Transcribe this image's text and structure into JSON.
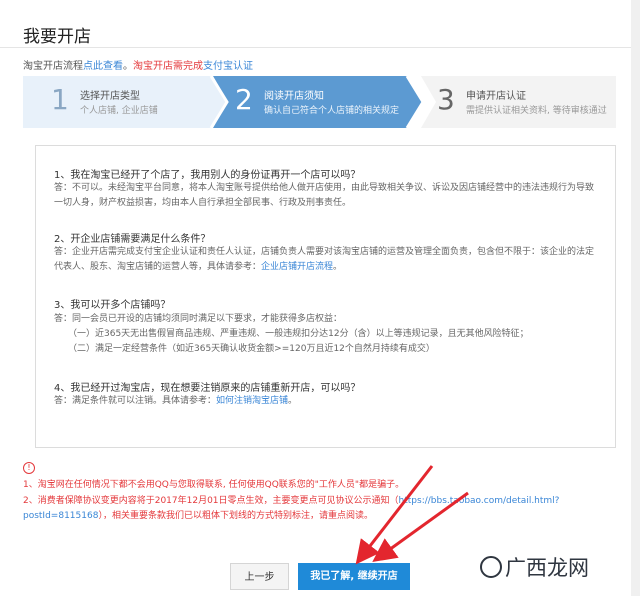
{
  "page": {
    "title": "我要开店"
  },
  "intro": {
    "prefix": "淘宝开店流程",
    "link": "点此查看",
    "sep": "。",
    "red_text": "淘宝开店需完成",
    "red_link": "支付宝认证"
  },
  "steps": [
    {
      "num": "1",
      "title": "选择开店类型",
      "desc": "个人店铺, 企业店铺"
    },
    {
      "num": "2",
      "title": "阅读开店须知",
      "desc": "确认自己符合个人店铺的相关规定"
    },
    {
      "num": "3",
      "title": "申请开店认证",
      "desc": "需提供认证相关资料, 等待审核通过"
    }
  ],
  "faq": [
    {
      "q": "1、我在淘宝已经开了个店了，我用别人的身份证再开一个店可以吗？",
      "a": "答：不可以。未经淘宝平台同意，将本人淘宝账号提供给他人做开店使用，由此导致相关争议、诉讼及因店铺经营中的违法违规行为导致一切人身，财产权益损害，均由本人自行承担全部民事、行政及刑事责任。"
    },
    {
      "q": "2、开企业店铺需要满足什么条件？",
      "a_pre": "答：企业开店需完成支付宝企业认证和责任人认证，店铺负责人需要对该淘宝店铺的运营及管理全面负责，包含但不限于：该企业的法定代表人、股东、淘宝店铺的运营人等，具体请参考：",
      "a_link": "企业店铺开店流程",
      "a_post": "。"
    },
    {
      "q": "3、我可以开多个店铺吗？",
      "a": "答：同一会员已开设的店铺均须同时满足以下要求，才能获得多店权益：",
      "a2": "（一）近365天无出售假冒商品违规、严重违规、一般违规扣分达12分（含）以上等违规记录，且无其他风险特征；",
      "a3": "（二）满足一定经营条件（如近365天确认收货金额>=120万且近12个自然月持续有成交）"
    },
    {
      "q": "4、我已经开过淘宝店，现在想要注销原来的店铺重新开店，可以吗？",
      "a_pre": "答：满足条件就可以注销。具体请参考：",
      "a_link": "如何注销淘宝店铺",
      "a_post": "。"
    }
  ],
  "notice": {
    "icon": "!",
    "line1": "1、淘宝网在任何情况下都不会用QQ与您取得联系, 任何使用QQ联系您的\"工作人员\"都是骗子。",
    "line2_pre": "2、消费者保障协议变更内容将于2017年12月01日零点生效，主要变更点可见协议公示通知（",
    "line2_link": "https://bbs.taobao.com/detail.html?postId=8115168",
    "line2_post": "），相关重要条款我们已以粗体下划线的方式特别标注，请重点阅读。"
  },
  "buttons": {
    "prev": "上一步",
    "next": "我已了解, 继续开店"
  },
  "watermark": "广西龙网",
  "colors": {
    "step_done": "#e8f1fa",
    "step_active": "#5c9ad2",
    "step_todo": "#f3f3f3",
    "primary": "#1f8ad8",
    "danger": "#e4393c",
    "arrow": "#e3262e"
  }
}
